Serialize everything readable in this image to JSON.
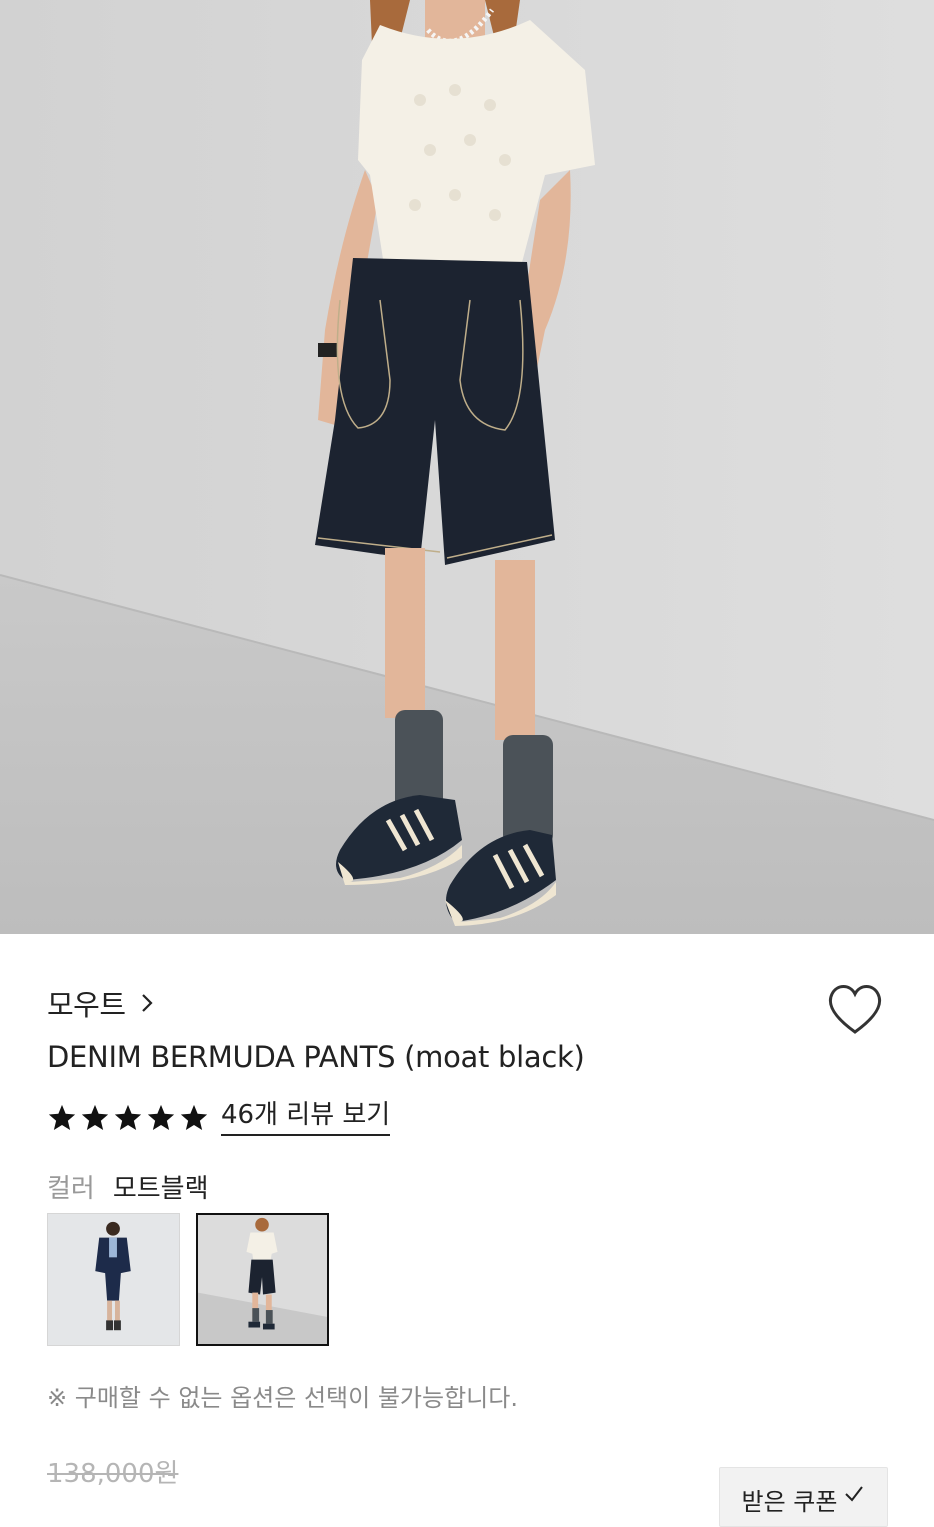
{
  "product": {
    "brand": "모우트",
    "title": "DENIM BERMUDA PANTS (moat black)",
    "rating_stars": 5,
    "review_link": "46개 리뷰 보기",
    "color_label": "컬러",
    "color_value": "모트블랙",
    "notice": "※ 구매할 수 없는 옵션은 선택이 불가능합니다.",
    "original_price": "138,000원",
    "coupon_button": "받은 쿠폰"
  },
  "colors": {
    "text": "#222222",
    "muted": "#999999",
    "star": "#111111"
  },
  "icons": {
    "brand_link": "chevron-right-icon",
    "wishlist": "heart-outline-icon",
    "rating": "star-filled-icon",
    "coupon": "check-icon"
  }
}
